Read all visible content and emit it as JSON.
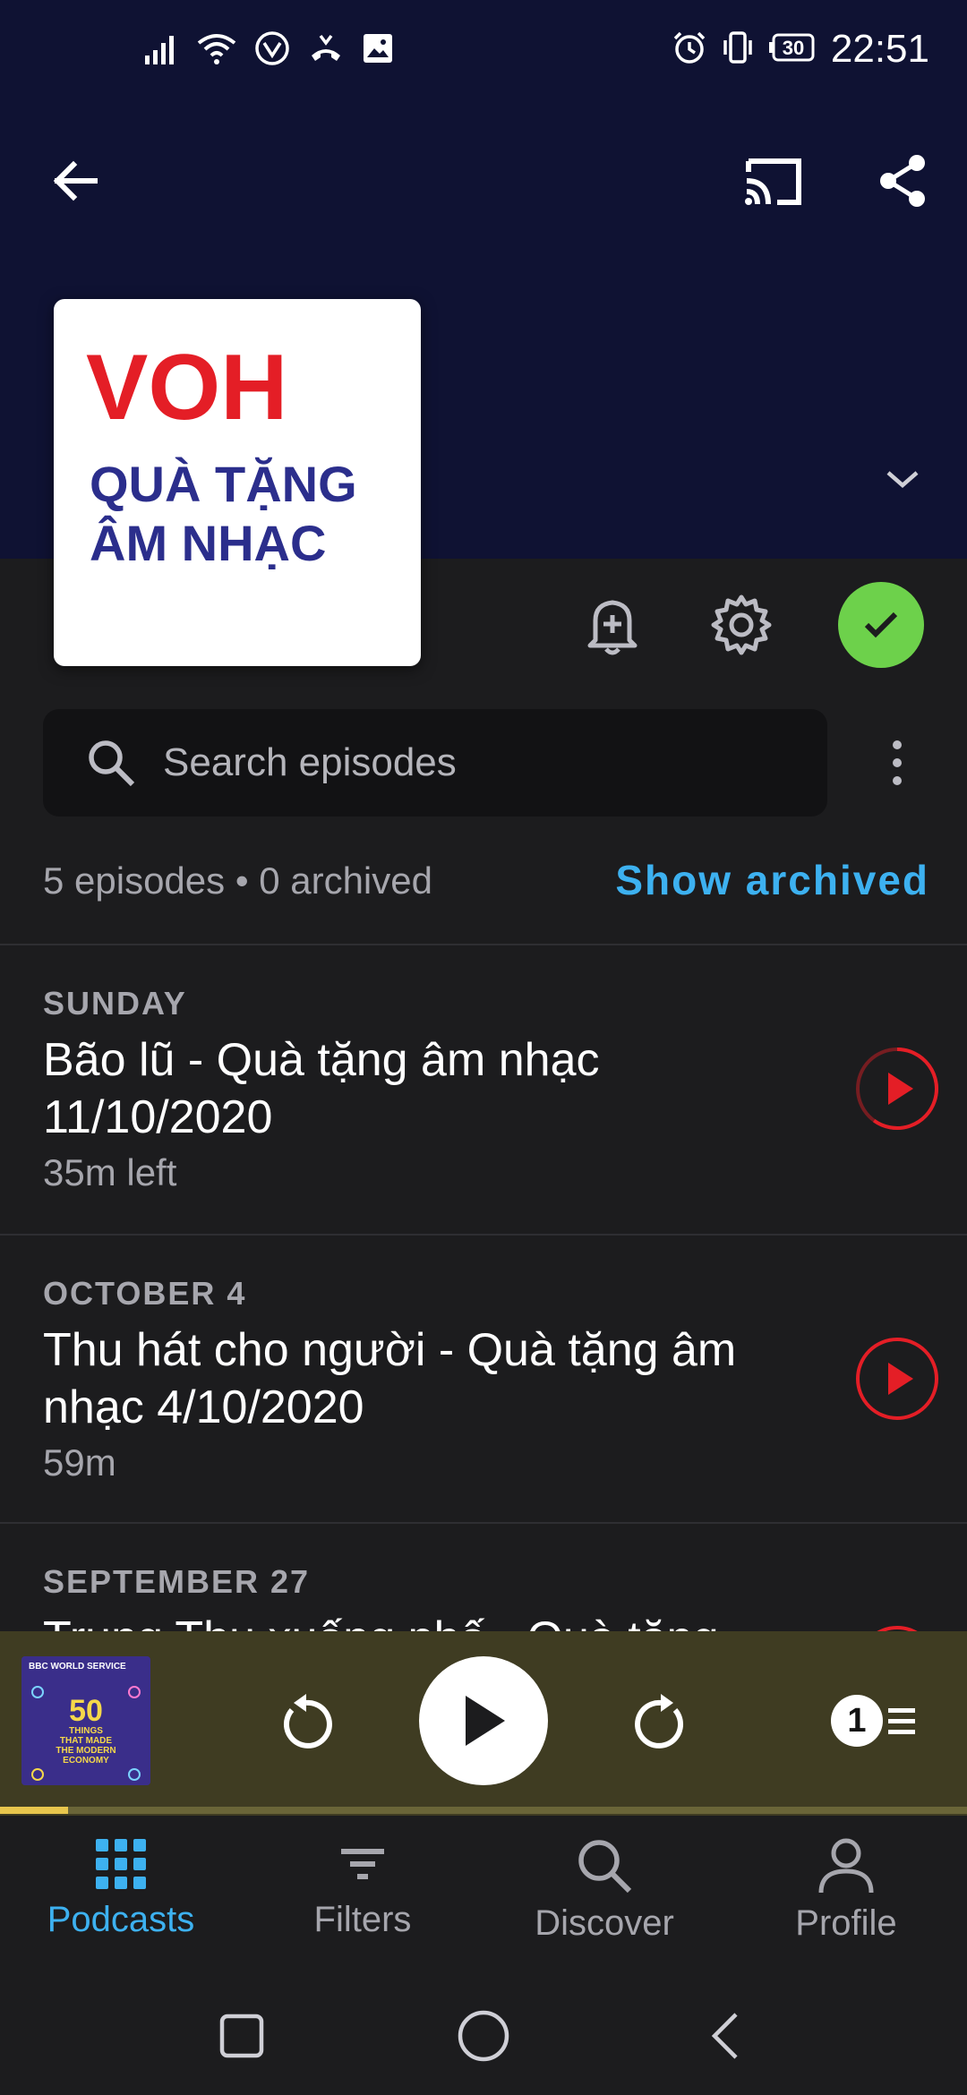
{
  "status_bar": {
    "time": "22:51",
    "battery": "30",
    "icons": [
      "signal-icon",
      "wifi-icon",
      "vpn-icon",
      "call-icon",
      "image-icon",
      "alarm-icon",
      "vibrate-icon",
      "battery-icon"
    ]
  },
  "toolbar": {
    "back_icon": "arrow-left-icon",
    "cast_icon": "cast-icon",
    "share_icon": "share-icon",
    "expand_icon": "chevron-down-icon"
  },
  "podcast": {
    "artwork_logo": "VOH",
    "artwork_line1": "QUÀ TẶNG",
    "artwork_line2": "ÂM NHẠC",
    "logo_color": "#e41e26",
    "title_color": "#2b2e8c"
  },
  "actions": {
    "notify_icon": "bell-plus-icon",
    "settings_icon": "gear-icon",
    "subscribed_icon": "check-icon",
    "subscribed_color": "#6dd14b"
  },
  "search": {
    "placeholder": "Search episodes",
    "value": ""
  },
  "summary": {
    "counts": "5 episodes • 0 archived",
    "show_archived": "Show archived"
  },
  "episodes": [
    {
      "date": "SUNDAY",
      "title": "Bão lũ - Quà tặng âm nhạc 11/10/2020",
      "meta": "35m left",
      "progress": 0.4
    },
    {
      "date": "OCTOBER 4",
      "title": "Thu hát cho người - Quà tặng âm nhạc 4/10/2020",
      "meta": "59m",
      "progress": 0
    },
    {
      "date": "SEPTEMBER 27",
      "title": "Trung Thu xuống phố - Quà tặng",
      "meta": "",
      "progress": 0
    }
  ],
  "mini_player": {
    "art_top": "BBC WORLD SERVICE",
    "art_number": "50",
    "art_line1": "THINGS",
    "art_line2": "THAT MADE",
    "art_line3": "THE MODERN",
    "art_line4": "ECONOMY",
    "queue_count": "1",
    "progress_fraction": 0.07,
    "accent": "#e8c64d"
  },
  "nav": {
    "items": [
      {
        "label": "Podcasts",
        "icon": "grid-icon",
        "active": true
      },
      {
        "label": "Filters",
        "icon": "filter-icon",
        "active": false
      },
      {
        "label": "Discover",
        "icon": "search-icon",
        "active": false
      },
      {
        "label": "Profile",
        "icon": "person-icon",
        "active": false
      }
    ],
    "active_color": "#3db1f0"
  }
}
